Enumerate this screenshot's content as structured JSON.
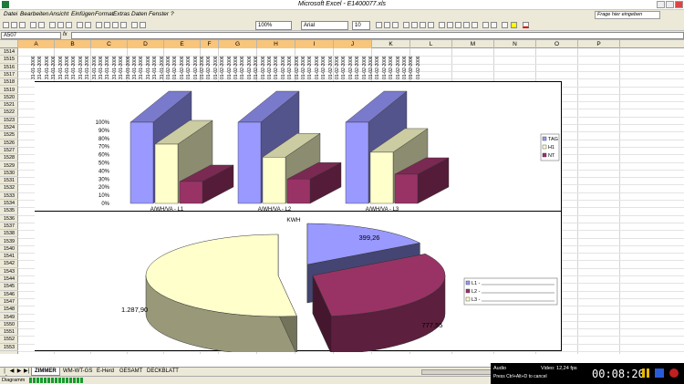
{
  "window": {
    "title": "Microsoft Excel - E1400077.xls"
  },
  "menu": {
    "items": [
      "Datei",
      "Bearbeiten",
      "Ansicht",
      "Einfügen",
      "Format",
      "Extras",
      "Daten",
      "Fenster",
      "?"
    ],
    "help_placeholder": "Frage hier eingeben"
  },
  "toolbar": {
    "zoom": "100%",
    "font": "Arial",
    "font_size": "10"
  },
  "formula_bar": {
    "name_box": "A507",
    "fx": "fx",
    "content": ""
  },
  "columns": [
    "A",
    "B",
    "C",
    "D",
    "E",
    "F",
    "G",
    "H",
    "I",
    "J",
    "K",
    "L",
    "M",
    "N",
    "O",
    "P"
  ],
  "rows": [
    "1514",
    "1515",
    "1516",
    "1517",
    "1518",
    "1519",
    "1520",
    "1521",
    "1522",
    "1523",
    "1524",
    "1525",
    "1526",
    "1527",
    "1528",
    "1529",
    "1530",
    "1531",
    "1532",
    "1533",
    "1534",
    "1535",
    "1536",
    "1537",
    "1538",
    "1539",
    "1540",
    "1541",
    "1542",
    "1543",
    "1544",
    "1545",
    "1546",
    "1547",
    "1548",
    "1549",
    "1550",
    "1551",
    "1552",
    "1553"
  ],
  "date_cells": [
    "31-01-2006",
    "31-01-2006",
    "31-01-2006",
    "31-01-2006",
    "31-01-2006",
    "31-01-2006",
    "31-01-2006",
    "31-01-2006",
    "31-01-2006",
    "31-01-2006",
    "31-01-2006",
    "31-01-2006",
    "31-01-2006",
    "31-01-2006",
    "31-01-2006",
    "31-01-2006",
    "31-01-2006",
    "31-01-2006",
    "31-01-2006",
    "31-01-2006",
    "01-02-2006",
    "01-02-2006",
    "01-02-2006",
    "01-02-2006",
    "01-02-2006",
    "01-02-2006",
    "01-02-2006",
    "01-02-2006",
    "01-02-2006",
    "01-02-2006",
    "01-02-2006",
    "01-02-2006",
    "01-02-2006",
    "01-02-2006",
    "01-02-2006",
    "01-02-2006",
    "01-02-2006",
    "01-02-2006",
    "01-02-2006",
    "01-02-2006",
    "01-02-2006",
    "01-02-2006",
    "01-02-2006",
    "01-02-2006",
    "01-02-2006",
    "01-02-2006",
    "01-02-2006",
    "01-02-2006",
    "01-02-2006",
    "01-02-2006",
    "01-02-2006",
    "01-02-2006",
    "01-02-2006",
    "01-02-2006",
    "01-02-2006",
    "01-02-2006",
    "01-02-2006",
    "01-02-2006"
  ],
  "chart_data": [
    {
      "type": "bar",
      "title": "",
      "categories": [
        "A/WH/VA - L1",
        "A/WH/VA - L2",
        "A/WH/VA - L3"
      ],
      "series": [
        {
          "name": "TAG",
          "values": [
            100,
            100,
            100
          ],
          "color": "#9999ff"
        },
        {
          "name": "H1",
          "values": [
            73,
            57,
            63
          ],
          "color": "#ffffcc"
        },
        {
          "name": "NT",
          "values": [
            27,
            30,
            36
          ],
          "color": "#993366"
        }
      ],
      "yticks": [
        "0%",
        "10%",
        "20%",
        "30%",
        "40%",
        "50%",
        "60%",
        "70%",
        "80%",
        "90%",
        "100%"
      ],
      "ylim": [
        0,
        100
      ],
      "legend": "right"
    },
    {
      "type": "pie",
      "title": "KWH",
      "slices": [
        {
          "label": "L1",
          "value": 399.26,
          "display": "399,26",
          "color": "#9999ff"
        },
        {
          "label": "L2",
          "value": 777.55,
          "display": "777,55",
          "color": "#993366"
        },
        {
          "label": "L3",
          "value": 1287.9,
          "display": "1.287,90",
          "color": "#ffffcc"
        }
      ],
      "legend_entries": [
        "L1 -",
        "L2 -",
        "L3 -"
      ],
      "legend": "right"
    }
  ],
  "sheet_tabs": [
    "ZIMMER",
    "WM-WT-GS",
    "E-Herd",
    "GESAMT",
    "DECKBLATT"
  ],
  "active_tab": "ZIMMER",
  "tab_nav": [
    "|◀",
    "◀",
    "▶",
    "▶|"
  ],
  "status": {
    "text": "Diagramm"
  },
  "recorder": {
    "audio": "Audio",
    "video": "Video: 12,24 fps",
    "hint": "Press Ctrl+Alt+D to cancel",
    "time": "00:08:20"
  },
  "colors": {
    "ui_bg": "#ece9d8",
    "selected_header": "#f9c57a"
  }
}
